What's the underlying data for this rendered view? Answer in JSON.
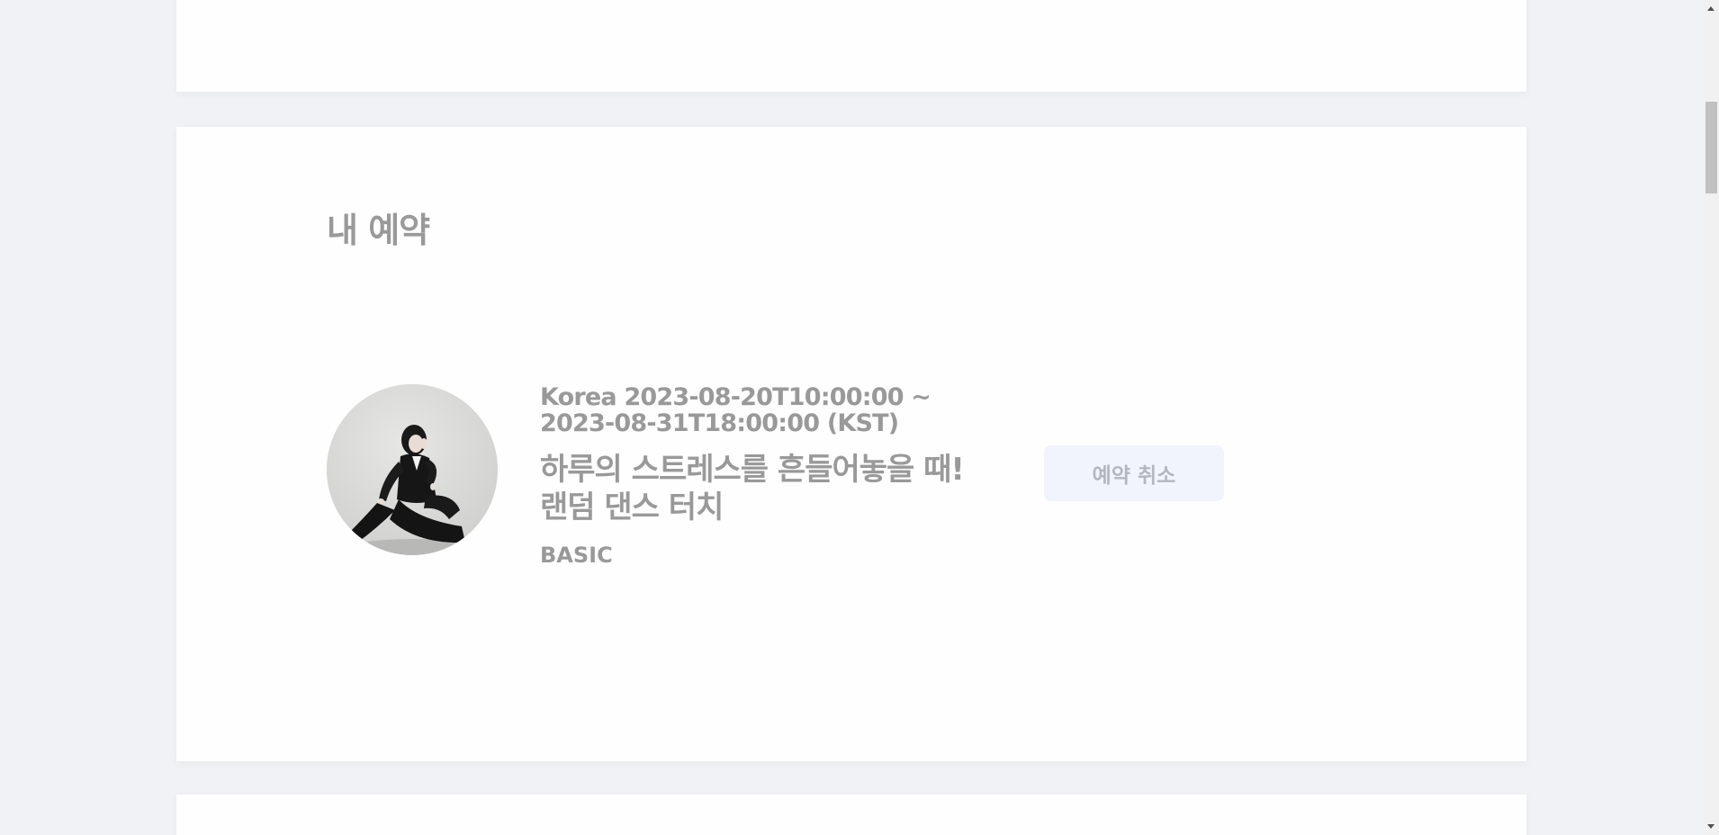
{
  "reservations_section": {
    "title": "내 예약",
    "items": [
      {
        "date_range": "Korea 2023-08-20T10:00:00 ~ 2023-08-31T18:00:00 (KST)",
        "title": "하루의 스트레스를 흔들어놓을 때! 랜덤 댄스 터치",
        "tier": "BASIC",
        "cancel_label": "예약 취소",
        "thumbnail": "dancer-portrait-image"
      }
    ]
  },
  "colors": {
    "page_background": "#f1f2f6",
    "card_background": "#fefefe",
    "text_muted": "#999999",
    "button_background": "#f1f3fd",
    "button_text": "#b4b6c0"
  }
}
